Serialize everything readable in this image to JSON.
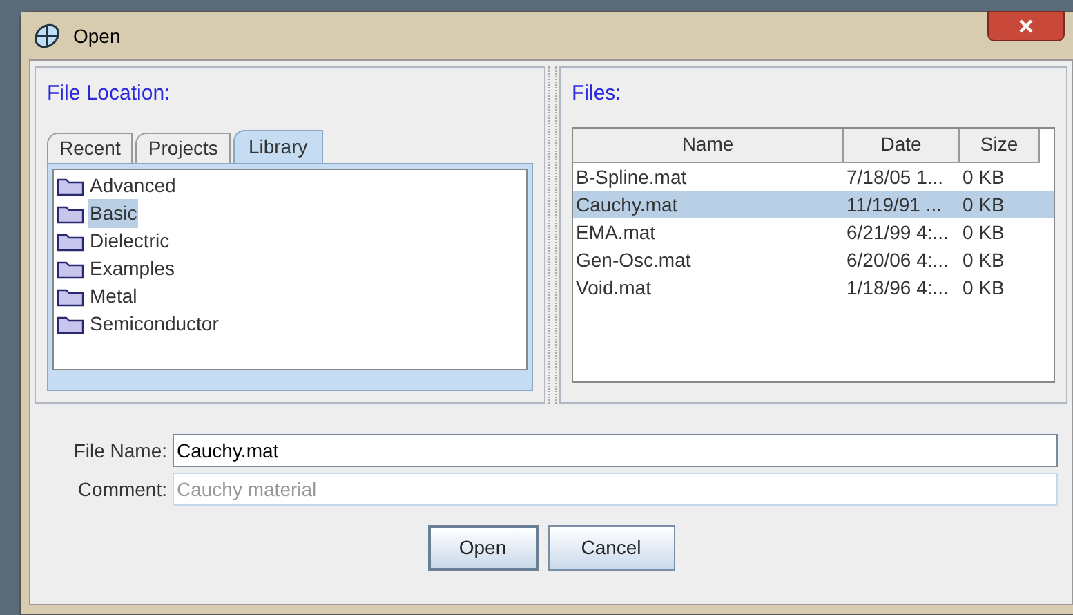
{
  "window": {
    "title": "Open"
  },
  "location": {
    "label": "File Location:",
    "tabs": [
      {
        "label": "Recent",
        "selected": false
      },
      {
        "label": "Projects",
        "selected": false
      },
      {
        "label": "Library",
        "selected": true
      }
    ],
    "folders": [
      {
        "name": "Advanced",
        "selected": false
      },
      {
        "name": "Basic",
        "selected": true
      },
      {
        "name": "Dielectric",
        "selected": false
      },
      {
        "name": "Examples",
        "selected": false
      },
      {
        "name": "Metal",
        "selected": false
      },
      {
        "name": "Semiconductor",
        "selected": false
      }
    ]
  },
  "files": {
    "label": "Files:",
    "columns": [
      "Name",
      "Date",
      "Size"
    ],
    "rows": [
      {
        "cells": [
          "B-Spline.mat",
          "7/18/05 1...",
          "0 KB"
        ],
        "selected": false
      },
      {
        "cells": [
          "Cauchy.mat",
          "11/19/91 ...",
          "0 KB"
        ],
        "selected": true
      },
      {
        "cells": [
          "EMA.mat",
          "6/21/99 4:...",
          "0 KB"
        ],
        "selected": false
      },
      {
        "cells": [
          "Gen-Osc.mat",
          "6/20/06 4:...",
          "0 KB"
        ],
        "selected": false
      },
      {
        "cells": [
          "Void.mat",
          "1/18/96 4:...",
          "0 KB"
        ],
        "selected": false
      }
    ]
  },
  "fields": [
    {
      "label": "File Name:",
      "value": "Cauchy.mat",
      "disabled": false
    },
    {
      "label": "Comment:",
      "value": "Cauchy material",
      "disabled": true
    }
  ],
  "buttons": [
    {
      "label": "Open",
      "default": true
    },
    {
      "label": "Cancel",
      "default": false
    }
  ]
}
